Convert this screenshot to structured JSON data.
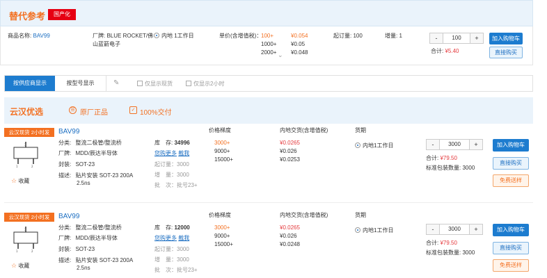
{
  "alt_header": {
    "title": "替代参考",
    "badge": "国产化"
  },
  "alt_product": {
    "name_label": "商品名称:",
    "name": "BAV99",
    "maker_label": "厂牌:",
    "maker_line1": "BLUE ROCKET/佛",
    "maker_line2": "山蓝箭电子",
    "delivery": "内地 1工作日",
    "price_label": "单价(含增值税)：",
    "tiers": [
      {
        "qty": "100+",
        "price": "¥0.054"
      },
      {
        "qty": "1000+",
        "price": "¥0.05"
      },
      {
        "qty": "2000+",
        "price": "¥0.048"
      }
    ],
    "moq_label": "起订量:",
    "moq": "100",
    "inc_label": "增量:",
    "inc": "1",
    "qty": "100",
    "total_label": "合计:",
    "total": "¥5.40",
    "add_cart": "加入购物车",
    "buy_now": "直接购买"
  },
  "tabs": {
    "by_supplier": "按供应商显示",
    "by_model": "按型号显示",
    "filter_stock": "仅显示现货",
    "filter_2h": "仅显示2小时"
  },
  "section": {
    "title": "云汉优选",
    "genuine": "原厂正品",
    "delivery": "100%交付"
  },
  "columns": {
    "tiers": "价格梯度",
    "price": "内地交货(含增值税)",
    "source": "货期"
  },
  "products": [
    {
      "badge": "云汉现货 2小时发",
      "name": "BAV99",
      "category_label": "分类:",
      "category": "整流二极管/整流桥",
      "brand_label": "厂牌:",
      "brand": "MDD/辰达半导体",
      "package_label": "封装:",
      "package": "SOT-23",
      "desc_label": "描述:",
      "desc_line1": "贴片安装 SOT-23 200A",
      "desc_line2": "2.5ns",
      "favorite": "收藏",
      "stock_label": "库　存:",
      "stock": "34996",
      "more_stock": "您购更多",
      "ask": "截我",
      "moq": "起订量：3000",
      "inc": "增　量：3000",
      "batch": "批　次：批号23+",
      "tiers": [
        {
          "qty": "3000+",
          "price": "¥0.0265"
        },
        {
          "qty": "9000+",
          "price": "¥0.026"
        },
        {
          "qty": "15000+",
          "price": "¥0.0253"
        }
      ],
      "source": "内地1工作日",
      "qty": "3000",
      "total_label": "合计:",
      "total": "¥79.50",
      "pack_label": "标准包装数量:",
      "pack": "3000",
      "add_cart": "加入购物车",
      "buy_now": "直接购买",
      "sample": "免费送样"
    },
    {
      "badge": "云汉现货 2小时发",
      "name": "BAV99",
      "category_label": "分类:",
      "category": "整流二极管/整流桥",
      "brand_label": "厂牌:",
      "brand": "MDD/辰达半导体",
      "package_label": "封装:",
      "package": "SOT-23",
      "desc_label": "描述:",
      "desc_line1": "贴片安装 SOT-23 200A",
      "desc_line2": "2.5ns",
      "favorite": "收藏",
      "stock_label": "库　存:",
      "stock": "12000",
      "more_stock": "您购更多",
      "ask": "截我",
      "moq": "起订量：3000",
      "inc": "增　量：3000",
      "batch": "批　次：批号23+",
      "tiers": [
        {
          "qty": "3000+",
          "price": "¥0.0265"
        },
        {
          "qty": "9000+",
          "price": "¥0.026"
        },
        {
          "qty": "15000+",
          "price": "¥0.0248"
        }
      ],
      "source": "内地1工作日",
      "qty": "3000",
      "total_label": "合计:",
      "total": "¥79.50",
      "pack_label": "标准包装数量:",
      "pack": "3000",
      "add_cart": "加入购物车",
      "buy_now": "直接购买",
      "sample": "免费送样"
    }
  ]
}
